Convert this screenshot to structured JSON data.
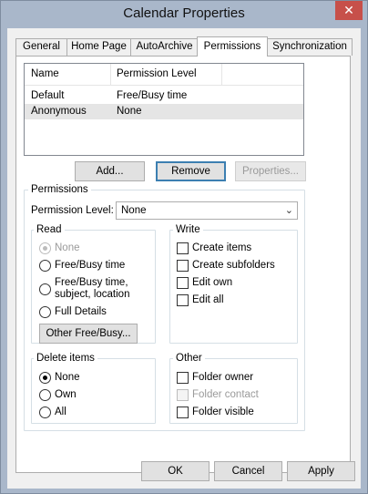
{
  "window": {
    "title": "Calendar Properties",
    "close_glyph": "✕"
  },
  "tabs": [
    {
      "label": "General"
    },
    {
      "label": "Home Page"
    },
    {
      "label": "AutoArchive"
    },
    {
      "label": "Permissions"
    },
    {
      "label": "Synchronization"
    }
  ],
  "active_tab": "Permissions",
  "list": {
    "columns": [
      "Name",
      "Permission Level"
    ],
    "rows": [
      {
        "name": "Default",
        "level": "Free/Busy time",
        "selected": false
      },
      {
        "name": "Anonymous",
        "level": "None",
        "selected": true
      }
    ]
  },
  "list_buttons": {
    "add": "Add...",
    "remove": "Remove",
    "properties": "Properties..."
  },
  "permissions": {
    "group_label": "Permissions",
    "level_label": "Permission Level:",
    "level_value": "None",
    "read": {
      "label": "Read",
      "options": [
        "None",
        "Free/Busy time",
        "Free/Busy time, subject, location",
        "Full Details"
      ],
      "selected": "None",
      "other_button": "Other Free/Busy..."
    },
    "write": {
      "label": "Write",
      "options": [
        "Create items",
        "Create subfolders",
        "Edit own",
        "Edit all"
      ]
    },
    "delete": {
      "label": "Delete items",
      "options": [
        "None",
        "Own",
        "All"
      ],
      "selected": "None"
    },
    "other": {
      "label": "Other",
      "options": [
        "Folder owner",
        "Folder contact",
        "Folder visible"
      ]
    }
  },
  "footer": {
    "ok": "OK",
    "cancel": "Cancel",
    "apply": "Apply"
  },
  "colors": {
    "titlebar": "#a9b7ca",
    "close": "#c7504a",
    "selection": "#e5e5e5",
    "focus": "#3c7fb1"
  }
}
